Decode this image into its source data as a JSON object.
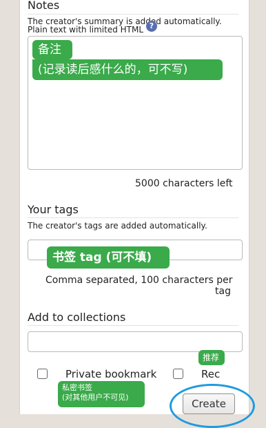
{
  "notes": {
    "title": "Notes",
    "hint_line1": "The creator's summary is added automatically.",
    "hint_line2": "Plain text with limited HTML",
    "help_icon": "?",
    "char_count": "5000 characters left",
    "annotation_line1": "备注",
    "annotation_line2": "(记录读后感什么的，可不写)"
  },
  "tags": {
    "title": "Your tags",
    "hint": "The creator's tags are added automatically.",
    "annotation": "书签 tag (可不填)",
    "help_line1": "Comma separated, 100 characters per",
    "help_line2": "tag"
  },
  "collections": {
    "title": "Add to collections"
  },
  "options": {
    "private_label": "Private bookmark",
    "rec_label": "Rec",
    "rec_annotation": "推荐",
    "private_annotation_line1": "私密书签",
    "private_annotation_line2": "(对其他用户不可见)"
  },
  "actions": {
    "create_label": "Create"
  },
  "colors": {
    "annotation": "#3aaa4a",
    "highlight_circle": "#1f9ae0"
  }
}
